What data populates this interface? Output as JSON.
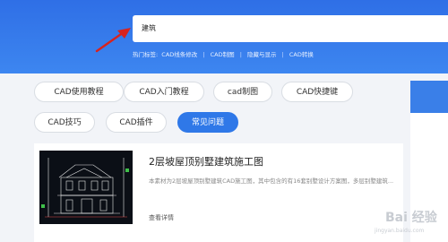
{
  "search": {
    "value": "建筑"
  },
  "hot_tags": {
    "label": "热门标签:",
    "items": [
      "CAD线条修改",
      "CAD制图",
      "隐藏与显示",
      "CAD转换"
    ],
    "separator": "|"
  },
  "categories": [
    {
      "label": "CAD使用教程",
      "active": false
    },
    {
      "label": "CAD入门教程",
      "active": false
    },
    {
      "label": "cad制图",
      "active": false
    },
    {
      "label": "CAD快捷键",
      "active": false
    },
    {
      "label": "CAD技巧",
      "active": false
    },
    {
      "label": "CAD插件",
      "active": false
    },
    {
      "label": "常见问题",
      "active": true
    }
  ],
  "article": {
    "title": "2层坡屋顶别墅建筑施工图",
    "description": "本素材为2层坡屋顶别墅建筑CAD施工图，其中包含的有16套别墅设计方案图，多层别墅建筑...",
    "more": "查看详情"
  },
  "watermark": {
    "brand": "Bai 经验",
    "url": "jingyan.baidu.com"
  },
  "colors": {
    "accent": "#2f78e8",
    "hero": "#3d86f0",
    "arrow": "#d8231e"
  }
}
